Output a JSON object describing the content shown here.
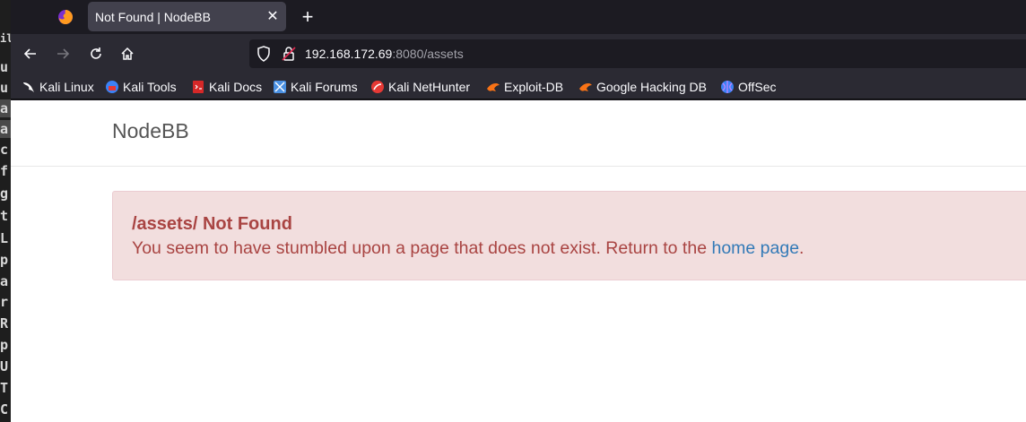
{
  "terminal_strip": {
    "chars": [
      "",
      "il",
      "u",
      "u",
      "a",
      "a",
      "c",
      "f",
      "g",
      "t",
      "L",
      "p",
      "a",
      "r",
      "R",
      "p",
      "U",
      "T",
      "C"
    ]
  },
  "browser": {
    "tab": {
      "title": "Not Found | NodeBB",
      "close_glyph": "✕"
    },
    "new_tab_glyph": "+",
    "url": {
      "host": "192.168.172.69",
      "rest": ":8080/assets"
    },
    "bookmarks": [
      {
        "label": "Kali Linux",
        "icon": "kali-dragon-icon",
        "color": "#ffffff"
      },
      {
        "label": "Kali Tools",
        "icon": "kali-tools-icon",
        "color": "#3b82f6"
      },
      {
        "label": "Kali Docs",
        "icon": "kali-docs-icon",
        "color": "#d62828"
      },
      {
        "label": "Kali Forums",
        "icon": "kali-forums-icon",
        "color": "#4a90e2"
      },
      {
        "label": "Kali NetHunter",
        "icon": "nethunter-icon",
        "color": "#e53935"
      },
      {
        "label": "Exploit-DB",
        "icon": "exploit-db-icon",
        "color": "#f97316"
      },
      {
        "label": "Google Hacking DB",
        "icon": "ghdb-icon",
        "color": "#f97316"
      },
      {
        "label": "OffSec",
        "icon": "offsec-icon",
        "color": "#3b82f6"
      }
    ]
  },
  "site": {
    "brand": "NodeBB",
    "alert": {
      "path": "/assets/",
      "title_suffix": " Not Found",
      "message": "You seem to have stumbled upon a page that does not exist. Return to the ",
      "link": "home page",
      "message_end": "."
    }
  },
  "colors": {
    "alert_bg": "#f2dede",
    "alert_text": "#a94442",
    "link": "#337ab7"
  }
}
